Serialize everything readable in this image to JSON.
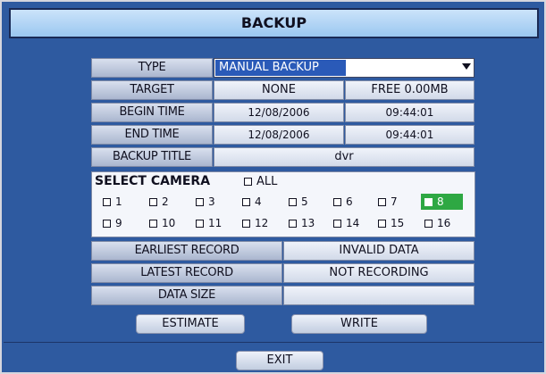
{
  "dialog": {
    "title": "BACKUP"
  },
  "type": {
    "label": "TYPE",
    "value": "MANUAL BACKUP"
  },
  "target": {
    "label": "TARGET",
    "value": "NONE",
    "free": "FREE 0.00MB"
  },
  "begin_time": {
    "label": "BEGIN TIME",
    "date": "12/08/2006",
    "time": "09:44:01"
  },
  "end_time": {
    "label": "END TIME",
    "date": "12/08/2006",
    "time": "09:44:01"
  },
  "backup_title": {
    "label": "BACKUP TITLE",
    "value": "dvr"
  },
  "select_camera": {
    "label": "SELECT CAMERA",
    "all_label": "ALL",
    "all_checked": false,
    "cameras": [
      {
        "label": "1",
        "checked": false
      },
      {
        "label": "2",
        "checked": false
      },
      {
        "label": "3",
        "checked": false
      },
      {
        "label": "4",
        "checked": false
      },
      {
        "label": "5",
        "checked": false
      },
      {
        "label": "6",
        "checked": false
      },
      {
        "label": "7",
        "checked": false
      },
      {
        "label": "8",
        "checked": false,
        "highlighted": true
      },
      {
        "label": "9",
        "checked": false
      },
      {
        "label": "10",
        "checked": false
      },
      {
        "label": "11",
        "checked": false
      },
      {
        "label": "12",
        "checked": false
      },
      {
        "label": "13",
        "checked": false
      },
      {
        "label": "14",
        "checked": false
      },
      {
        "label": "15",
        "checked": false
      },
      {
        "label": "16",
        "checked": false
      }
    ]
  },
  "earliest_record": {
    "label": "EARLIEST RECORD",
    "value": "INVALID DATA"
  },
  "latest_record": {
    "label": "LATEST RECORD",
    "value": "NOT RECORDING"
  },
  "data_size": {
    "label": "DATA SIZE",
    "value": ""
  },
  "buttons": {
    "estimate": "ESTIMATE",
    "write": "WRITE",
    "exit": "EXIT"
  },
  "colors": {
    "background": "#2e5aa0",
    "title_bar": "#b4d6f5",
    "selection": "#2a5ab8",
    "highlight": "#2ea843"
  }
}
